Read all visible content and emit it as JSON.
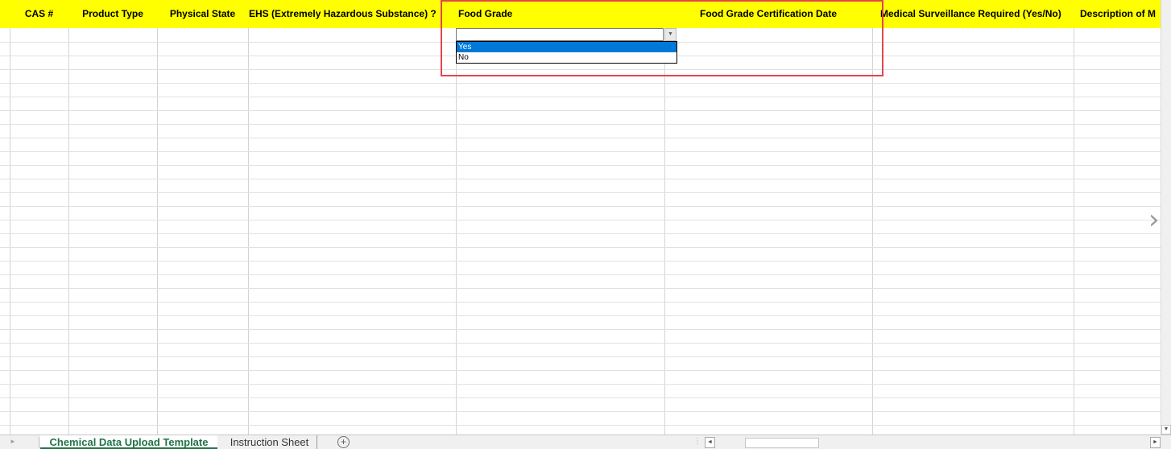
{
  "columns": {
    "cas": "CAS #",
    "product_type": "Product Type",
    "physical_state": "Physical State",
    "ehs": "EHS (Extremely Hazardous Substance) ?",
    "food_grade": "Food Grade",
    "food_grade_cert_date": "Food Grade Certification Date",
    "medical_surveillance": "Medical Surveillance Required (Yes/No)",
    "description": "Description of M"
  },
  "dropdown": {
    "options": [
      "Yes",
      "No"
    ],
    "highlighted": "Yes"
  },
  "sheets": {
    "active": "Chemical Data Upload Template",
    "other": "Instruction Sheet"
  },
  "colors": {
    "header_bg": "#ffff00",
    "highlight_box": "#e0474c",
    "active_tab": "#217346",
    "selected_option": "#0078d7"
  },
  "icons": {
    "add_sheet": "plus-circle-icon",
    "next": "chevron-right-icon",
    "dropdown": "dropdown-arrow-icon"
  }
}
